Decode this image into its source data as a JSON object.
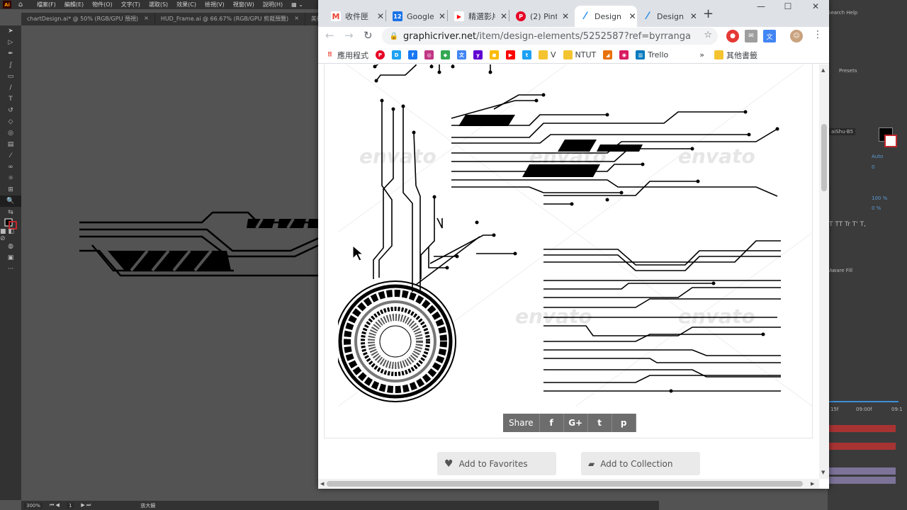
{
  "illustrator": {
    "menu": [
      "檔案(F)",
      "編輯(E)",
      "物件(O)",
      "文字(T)",
      "選取(S)",
      "效果(C)",
      "檢視(V)",
      "視窗(W)",
      "說明(H)"
    ],
    "doc_tabs": [
      {
        "label": "chartDesign.ai* @ 50% (RGB/GPU 預視)"
      },
      {
        "label": "HUD_Frame.ai @ 66.67% (RGB/GPU 剪裁預覽)"
      },
      {
        "label": "美術"
      }
    ],
    "status": {
      "zoom": "300%",
      "artboard": "1",
      "mode": "放大鏡"
    },
    "right_panel": {
      "search_help": "Search Help",
      "presets": "Presets",
      "font": "aiShu-B5",
      "leading": "Auto",
      "tracking": "0",
      "scale_v": "100 %",
      "baseline": "0 %",
      "type_buttons": "T  TT  Tr  T'  T,",
      "aware_fill": "Aware Fill",
      "timeline": [
        "15f",
        "09:00f",
        "09:1"
      ]
    }
  },
  "browser": {
    "tabs": [
      {
        "title": "收件匣",
        "icon": "gmail-icon",
        "icon_color": "#ea4335",
        "icon_text": "M"
      },
      {
        "title": "Google",
        "icon": "calendar-icon",
        "icon_color": "#1a73e8",
        "icon_text": "12"
      },
      {
        "title": "精選影片",
        "icon": "youtube-icon",
        "icon_color": "#ff0000",
        "icon_text": "▶"
      },
      {
        "title": "(2) Pint",
        "icon": "pinterest-icon",
        "icon_color": "#e60023",
        "icon_text": "P"
      },
      {
        "title": "Design",
        "icon": "envato-icon",
        "icon_color": "#1e88e5",
        "icon_text": "⁄",
        "active": true
      },
      {
        "title": "Design",
        "icon": "envato-icon",
        "icon_color": "#1e88e5",
        "icon_text": "⁄"
      }
    ],
    "new_tab": "+",
    "window_controls": {
      "minimize": "—",
      "maximize": "☐",
      "close": "✕"
    },
    "url": {
      "host": "graphicriver.net",
      "path": "/item/design-elements/5252587?ref=byrranga"
    },
    "bookmarks": [
      {
        "label": "應用程式",
        "icon": "apps-grid-icon",
        "color": "#4285f4",
        "text": "⋮⋮"
      },
      {
        "label": "",
        "icon": "pinterest-icon",
        "color": "#e60023",
        "text": "P"
      },
      {
        "label": "",
        "icon": "bookmark-app-icon",
        "color": "#1da1f2",
        "text": "D"
      },
      {
        "label": "",
        "icon": "facebook-icon",
        "color": "#1877f2",
        "text": "f"
      },
      {
        "label": "",
        "icon": "instagram-icon",
        "color": "#c13584",
        "text": "◎"
      },
      {
        "label": "",
        "icon": "maps-icon",
        "color": "#34a853",
        "text": "◆"
      },
      {
        "label": "",
        "icon": "translate-icon",
        "color": "#4285f4",
        "text": "文"
      },
      {
        "label": "",
        "icon": "yahoo-icon",
        "color": "#6001d2",
        "text": "y"
      },
      {
        "label": "",
        "icon": "keep-icon",
        "color": "#fbbc04",
        "text": "◼"
      },
      {
        "label": "",
        "icon": "youtube-icon",
        "color": "#ff0000",
        "text": "▶"
      },
      {
        "label": "",
        "icon": "twitter-icon",
        "color": "#1da1f2",
        "text": "t"
      },
      {
        "label": "V",
        "icon": "folder-icon",
        "color": "#f4c430",
        "text": ""
      },
      {
        "label": "NTUT",
        "icon": "folder-icon",
        "color": "#f4c430",
        "text": ""
      },
      {
        "label": "",
        "icon": "bookmark-app-icon",
        "color": "#e8710a",
        "text": "◢"
      },
      {
        "label": "",
        "icon": "bookmark-app-icon",
        "color": "#d81b60",
        "text": "◉"
      },
      {
        "label": "Trello",
        "icon": "trello-icon",
        "color": "#0079bf",
        "text": "▥"
      }
    ],
    "bookmarks_more": "»",
    "other_bookmarks": "其他書籤",
    "page": {
      "watermark": "envato",
      "share_label": "Share",
      "share_buttons": [
        "f",
        "G+",
        "t",
        "p"
      ],
      "add_favorites": "Add to Favorites",
      "add_collection": "Add to Collection"
    }
  }
}
